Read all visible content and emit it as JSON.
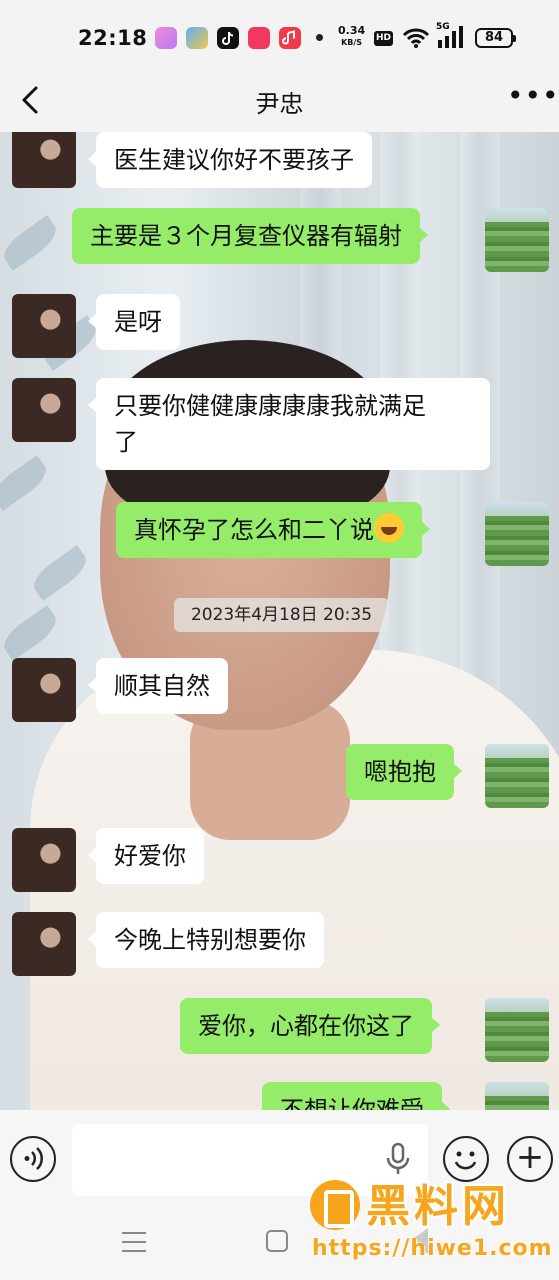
{
  "status_bar": {
    "time": "22:18",
    "net_speed_value": "0.34",
    "net_speed_unit": "KB/S",
    "hd_badge": "HD",
    "signal_label": "5G",
    "battery": "84",
    "app_icons": [
      "app-pink-icon",
      "weather-icon",
      "tiktok-icon",
      "app-red-icon",
      "music-icon"
    ]
  },
  "header": {
    "title": "尹忠",
    "back_icon": "chevron-left-icon",
    "more_label": "•••"
  },
  "messages": [
    {
      "side": "in",
      "text": "医生建议你好不要孩子"
    },
    {
      "side": "out",
      "text": "主要是３个月复查仪器有辐射"
    },
    {
      "side": "in",
      "text": "是呀"
    },
    {
      "side": "in",
      "text_line1": "只要你健健康康康康我就满足",
      "text_line2": "了"
    },
    {
      "side": "out",
      "text": "真怀孕了怎么和二丫说",
      "emoji": "laughing-crying-emoji"
    },
    {
      "side": "in",
      "text": "顺其自然"
    },
    {
      "side": "out",
      "text": "嗯抱抱"
    },
    {
      "side": "in",
      "text": "好爱你"
    },
    {
      "side": "in",
      "text": "今晚上特别想要你"
    },
    {
      "side": "out",
      "text": "爱你，心都在你这了"
    },
    {
      "side": "out",
      "text": "不想让你难受"
    }
  ],
  "timestamp": "2023年4月18日 20:35",
  "input_bar": {
    "voice_icon": "voice-icon",
    "mic_icon": "mic-icon",
    "emoji_icon": "smiley-icon",
    "plus_label": "+"
  },
  "watermark": {
    "name": "黑料网",
    "url": "https://hiwe1.com"
  },
  "colors": {
    "outgoing_bubble": "#95ec69",
    "incoming_bubble": "#ffffff",
    "watermark": "#f7a51c"
  }
}
